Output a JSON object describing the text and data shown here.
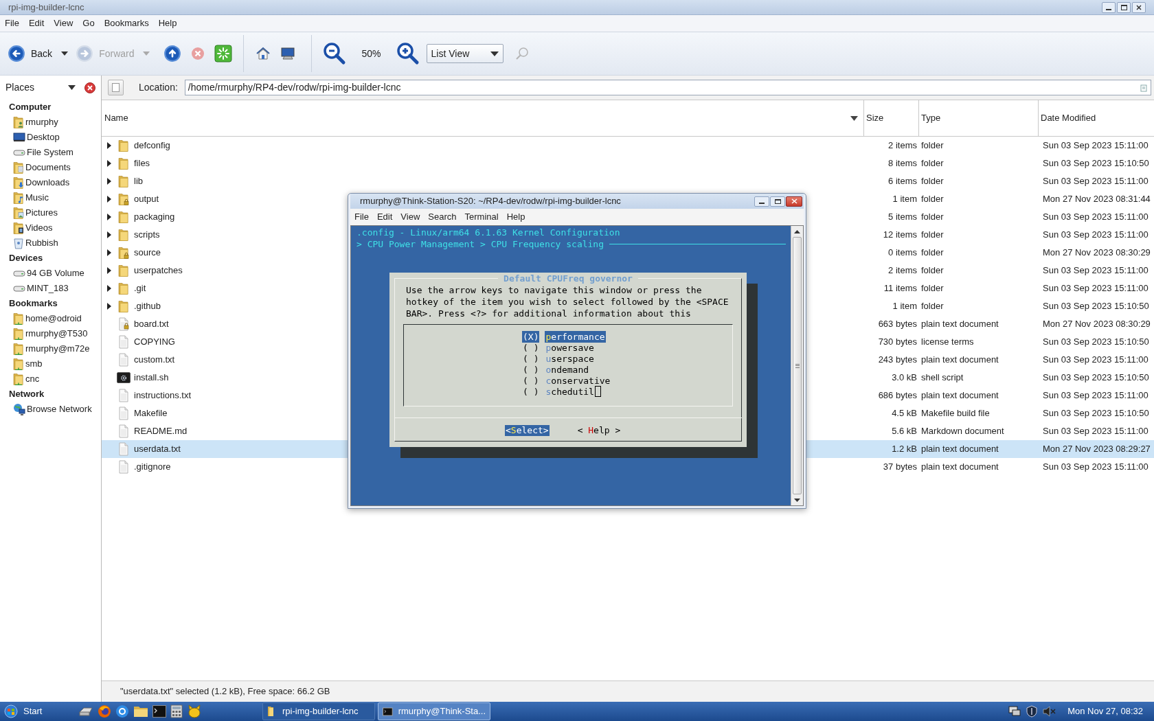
{
  "window": {
    "title": "rpi-img-builder-lcnc"
  },
  "menu": [
    "File",
    "Edit",
    "View",
    "Go",
    "Bookmarks",
    "Help"
  ],
  "toolbar": [
    {
      "kind": "back",
      "label": "Back",
      "disabled": false
    },
    {
      "kind": "forward",
      "label": "Forward",
      "disabled": true
    },
    {
      "kind": "up",
      "disabled": false
    },
    {
      "kind": "stop",
      "disabled": true
    },
    {
      "kind": "reload",
      "disabled": false
    },
    {
      "kind": "separator"
    },
    {
      "kind": "home",
      "disabled": false
    },
    {
      "kind": "computer",
      "disabled": false
    },
    {
      "kind": "separator"
    },
    {
      "kind": "zoom_out",
      "disabled": false
    },
    {
      "kind": "zoom_level",
      "label": "50%"
    },
    {
      "kind": "zoom_in",
      "disabled": false
    },
    {
      "kind": "view_select",
      "label": "List View"
    },
    {
      "kind": "search",
      "disabled": true
    }
  ],
  "sidebar": {
    "title": "Places",
    "sections": [
      {
        "heading": "Computer",
        "items": [
          {
            "label": "rmurphy",
            "kind": "home"
          },
          {
            "label": "Desktop",
            "kind": "desktop"
          },
          {
            "label": "File System",
            "kind": "drive"
          },
          {
            "label": "Documents",
            "kind": "documents"
          },
          {
            "label": "Downloads",
            "kind": "downloads"
          },
          {
            "label": "Music",
            "kind": "music"
          },
          {
            "label": "Pictures",
            "kind": "pictures"
          },
          {
            "label": "Videos",
            "kind": "videos"
          },
          {
            "label": "Rubbish",
            "kind": "trash"
          }
        ]
      },
      {
        "heading": "Devices",
        "items": [
          {
            "label": "94 GB Volume",
            "kind": "drive"
          },
          {
            "label": "MINT_183",
            "kind": "drive"
          }
        ]
      },
      {
        "heading": "Bookmarks",
        "items": [
          {
            "label": "home@odroid",
            "kind": "remote"
          },
          {
            "label": "rmurphy@T530",
            "kind": "remote"
          },
          {
            "label": "rmurphy@m72e",
            "kind": "remote"
          },
          {
            "label": "smb",
            "kind": "remote"
          },
          {
            "label": "cnc",
            "kind": "remote"
          }
        ]
      },
      {
        "heading": "Network",
        "items": [
          {
            "label": "Browse Network",
            "kind": "network"
          }
        ]
      }
    ]
  },
  "location": {
    "label": "Location:",
    "value": "/home/rmurphy/RP4-dev/rodw/rpi-img-builder-lcnc"
  },
  "table": {
    "columns": [
      "Name",
      "Size",
      "Type",
      "Date Modified"
    ],
    "rows": [
      {
        "name": "defconfig",
        "kind": "folder",
        "locked": false,
        "size": "2 items",
        "type": "folder",
        "modified": "Sun 03 Sep 2023 15:11:00",
        "selected": false
      },
      {
        "name": "files",
        "kind": "folder",
        "locked": false,
        "size": "8 items",
        "type": "folder",
        "modified": "Sun 03 Sep 2023 15:10:50",
        "selected": false
      },
      {
        "name": "lib",
        "kind": "folder",
        "locked": false,
        "size": "6 items",
        "type": "folder",
        "modified": "Sun 03 Sep 2023 15:11:00",
        "selected": false
      },
      {
        "name": "output",
        "kind": "folder",
        "locked": true,
        "size": "1 item",
        "type": "folder",
        "modified": "Mon 27 Nov 2023 08:31:44",
        "selected": false
      },
      {
        "name": "packaging",
        "kind": "folder",
        "locked": false,
        "size": "5 items",
        "type": "folder",
        "modified": "Sun 03 Sep 2023 15:11:00",
        "selected": false
      },
      {
        "name": "scripts",
        "kind": "folder",
        "locked": false,
        "size": "12 items",
        "type": "folder",
        "modified": "Sun 03 Sep 2023 15:11:00",
        "selected": false
      },
      {
        "name": "source",
        "kind": "folder",
        "locked": true,
        "size": "0 items",
        "type": "folder",
        "modified": "Mon 27 Nov 2023 08:30:29",
        "selected": false
      },
      {
        "name": "userpatches",
        "kind": "folder",
        "locked": false,
        "size": "2 items",
        "type": "folder",
        "modified": "Sun 03 Sep 2023 15:11:00",
        "selected": false
      },
      {
        "name": ".git",
        "kind": "folder",
        "locked": false,
        "size": "11 items",
        "type": "folder",
        "modified": "Sun 03 Sep 2023 15:11:00",
        "selected": false
      },
      {
        "name": ".github",
        "kind": "folder",
        "locked": false,
        "size": "1 item",
        "type": "folder",
        "modified": "Sun 03 Sep 2023 15:10:50",
        "selected": false
      },
      {
        "name": "board.txt",
        "kind": "file",
        "locked": true,
        "size": "663 bytes",
        "type": "plain text document",
        "modified": "Mon 27 Nov 2023 08:30:29",
        "selected": false
      },
      {
        "name": "COPYING",
        "kind": "file",
        "locked": false,
        "size": "730 bytes",
        "type": "license terms",
        "modified": "Sun 03 Sep 2023 15:10:50",
        "selected": false
      },
      {
        "name": "custom.txt",
        "kind": "file",
        "locked": false,
        "size": "243 bytes",
        "type": "plain text document",
        "modified": "Sun 03 Sep 2023 15:11:00",
        "selected": false
      },
      {
        "name": "install.sh",
        "kind": "script",
        "locked": false,
        "size": "3.0 kB",
        "type": "shell script",
        "modified": "Sun 03 Sep 2023 15:10:50",
        "selected": false
      },
      {
        "name": "instructions.txt",
        "kind": "file",
        "locked": false,
        "size": "686 bytes",
        "type": "plain text document",
        "modified": "Sun 03 Sep 2023 15:11:00",
        "selected": false
      },
      {
        "name": "Makefile",
        "kind": "file",
        "locked": false,
        "size": "4.5 kB",
        "type": "Makefile build file",
        "modified": "Sun 03 Sep 2023 15:10:50",
        "selected": false
      },
      {
        "name": "README.md",
        "kind": "file",
        "locked": false,
        "size": "5.6 kB",
        "type": "Markdown document",
        "modified": "Sun 03 Sep 2023 15:11:00",
        "selected": false
      },
      {
        "name": "userdata.txt",
        "kind": "file",
        "locked": false,
        "size": "1.2 kB",
        "type": "plain text document",
        "modified": "Mon 27 Nov 2023 08:29:27",
        "selected": true
      },
      {
        "name": ".gitignore",
        "kind": "file",
        "locked": false,
        "size": "37 bytes",
        "type": "plain text document",
        "modified": "Sun 03 Sep 2023 15:11:00",
        "selected": false
      }
    ]
  },
  "status_bar": "\"userdata.txt\" selected (1.2 kB), Free space: 66.2 GB",
  "terminal": {
    "title": "rmurphy@Think-Station-S20: ~/RP4-dev/rodw/rpi-img-builder-lcnc",
    "menu": [
      "File",
      "Edit",
      "View",
      "Search",
      "Terminal",
      "Help"
    ],
    "header": ".config - Linux/arm64 6.1.63 Kernel Configuration",
    "breadcrumb": "> CPU Power Management > CPU Frequency scaling",
    "dialog": {
      "title": "Default CPUFreq governor",
      "text": [
        "Use the arrow keys to navigate this window or press the",
        "hotkey of the item you wish to select followed by the <SPACE",
        "BAR>. Press <?> for additional information about this"
      ],
      "options": [
        {
          "marker": "(X)",
          "label": "performance",
          "selected": true
        },
        {
          "marker": "( )",
          "label": "powersave",
          "selected": false
        },
        {
          "marker": "( )",
          "label": "userspace",
          "selected": false
        },
        {
          "marker": "( )",
          "label": "ondemand",
          "selected": false
        },
        {
          "marker": "( )",
          "label": "conservative",
          "selected": false
        },
        {
          "marker": "( )",
          "label": "schedutil",
          "selected": false
        }
      ],
      "buttons": [
        {
          "label": "<Select>",
          "selected": true
        },
        {
          "label": "< Help >",
          "selected": false
        }
      ]
    }
  },
  "taskbar": {
    "start": "Start",
    "tasks": [
      {
        "label": "rpi-img-builder-lcnc",
        "kind": "folder",
        "selected": false
      },
      {
        "label": "rmurphy@Think-Sta...",
        "kind": "terminal",
        "selected": true
      }
    ],
    "clock": "Mon Nov 27, 08:32"
  }
}
